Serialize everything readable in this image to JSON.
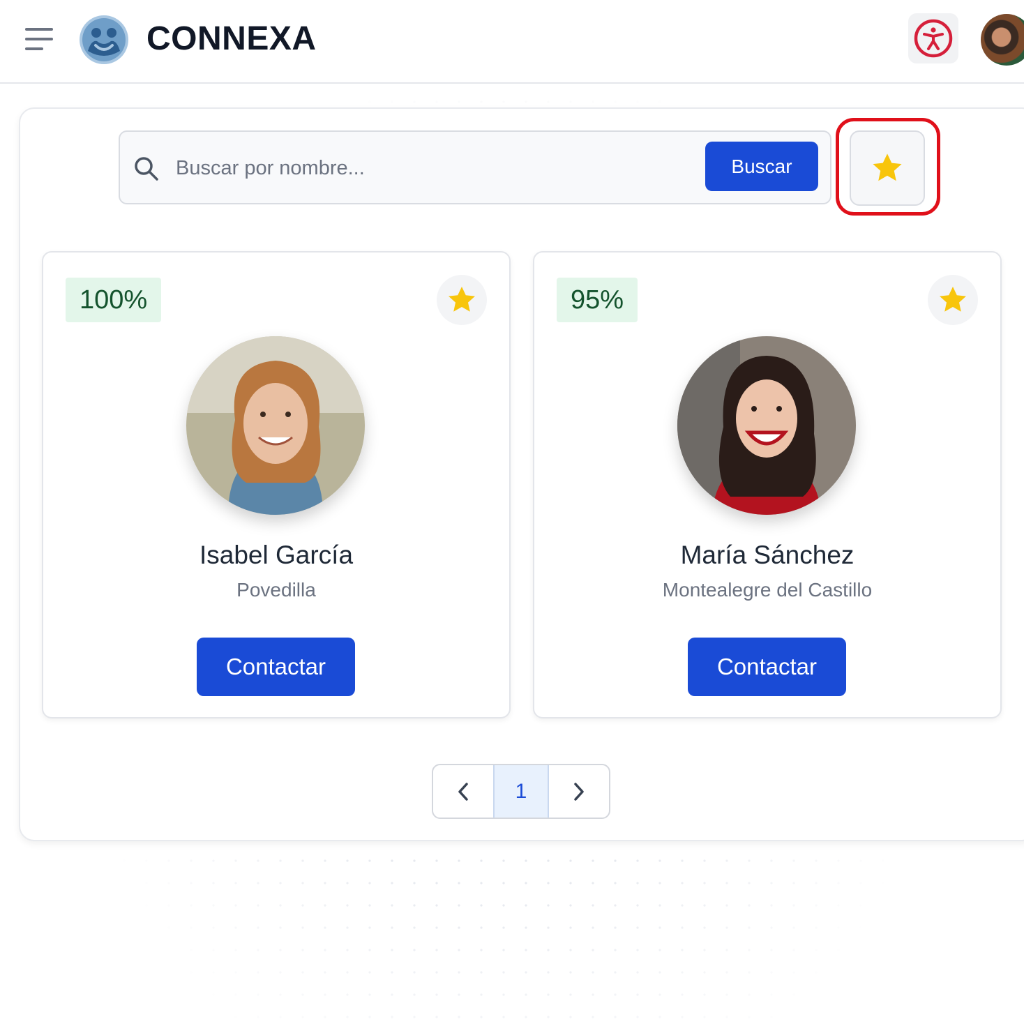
{
  "header": {
    "brand": "CONNEXA",
    "menu_icon": "hamburger-menu-icon",
    "logo_icon": "people-logo-icon",
    "accessibility_icon": "accessibility-icon",
    "accessibility_color": "#d51f3a"
  },
  "search": {
    "placeholder": "Buscar por nombre...",
    "button_label": "Buscar",
    "favorites_filter_icon": "star-icon"
  },
  "profiles": [
    {
      "match": "100%",
      "name": "Isabel García",
      "location": "Povedilla",
      "contact_label": "Contactar",
      "favorite": true
    },
    {
      "match": "95%",
      "name": "María Sánchez",
      "location": "Montealegre del Castillo",
      "contact_label": "Contactar",
      "favorite": true
    }
  ],
  "pagination": {
    "current": "1"
  },
  "colors": {
    "primary": "#1a4bd6",
    "star": "#f8c50c",
    "badge_bg": "#e3f6ea",
    "badge_text": "#14532d",
    "highlight": "#e0101a"
  }
}
